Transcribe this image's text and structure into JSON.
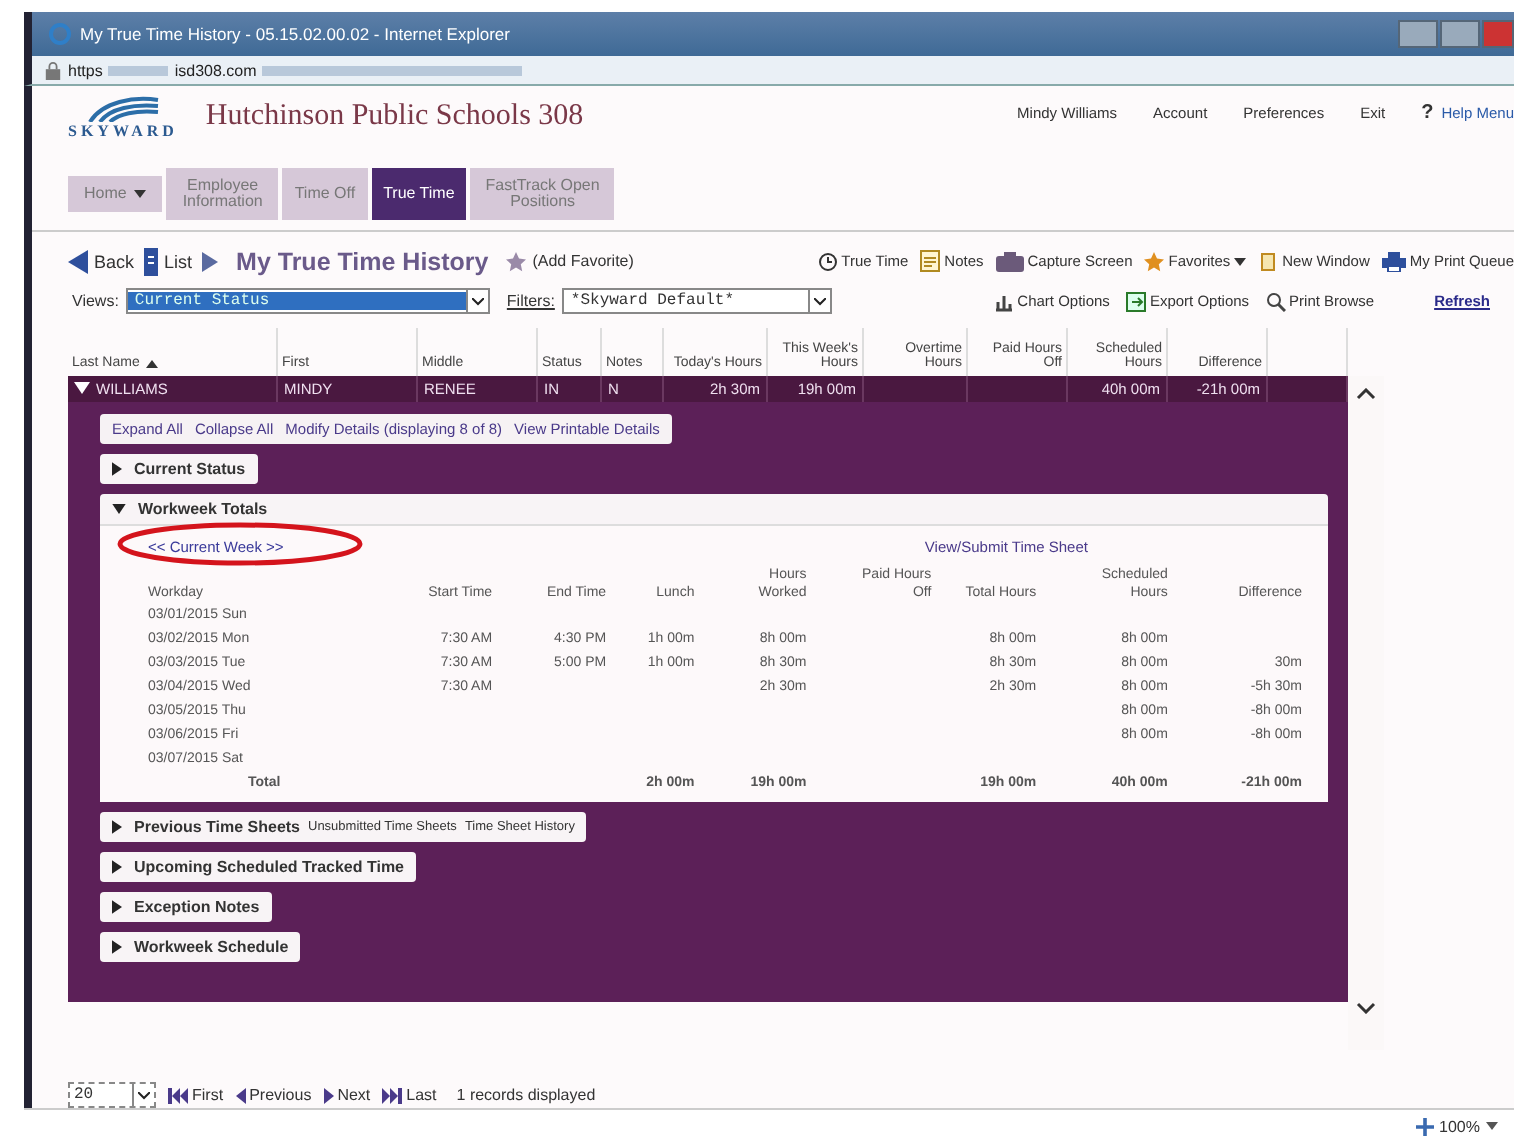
{
  "browser": {
    "title": "My True Time History - 05.15.02.00.02 - Internet Explorer",
    "url_scheme": "https",
    "url_domain": "isd308.com",
    "zoom": "100%"
  },
  "header": {
    "school": "Hutchinson Public Schools 308",
    "logo": "SKYWARD",
    "user_links": [
      "Mindy Williams",
      "Account",
      "Preferences",
      "Exit"
    ],
    "help_mark": "?",
    "help": "Help Menu"
  },
  "nav": [
    {
      "label": "Home",
      "dropdown": true,
      "selected": false
    },
    {
      "label": "Employee Information",
      "dropdown": false,
      "selected": false
    },
    {
      "label": "Time Off",
      "dropdown": false,
      "selected": false
    },
    {
      "label": "True Time",
      "dropdown": false,
      "selected": true
    },
    {
      "label": "FastTrack Open Positions",
      "dropdown": false,
      "selected": false
    }
  ],
  "toolbar": {
    "back": "Back",
    "list": "List",
    "page_title": "My True Time History",
    "add_favorite": "(Add Favorite)",
    "tools": [
      {
        "kind": "clock",
        "label": "True Time"
      },
      {
        "kind": "notes",
        "label": "Notes"
      },
      {
        "kind": "camera",
        "label": "Capture Screen"
      },
      {
        "kind": "star",
        "label": "Favorites"
      },
      {
        "kind": "window",
        "label": "New Window"
      },
      {
        "kind": "printer",
        "label": "My Print Queue"
      }
    ]
  },
  "views": {
    "label": "Views:",
    "value": "Current Status",
    "filters_label": "Filters:",
    "filters_value": "*Skyward Default*",
    "options": [
      {
        "kind": "chart",
        "label": "Chart Options"
      },
      {
        "kind": "export",
        "label": "Export Options"
      },
      {
        "kind": "print",
        "label": "Print Browse"
      }
    ],
    "refresh": "Refresh"
  },
  "grid": {
    "columns": [
      {
        "label": "Last Name",
        "sorted": true
      },
      {
        "label": "First",
        "sorted": false
      },
      {
        "label": "Middle",
        "sorted": false
      },
      {
        "label": "Status",
        "sorted": false
      },
      {
        "label": "Notes",
        "sorted": false
      },
      {
        "label": "Today's Hours",
        "sorted": false
      },
      {
        "label": "This Week's Hours",
        "sorted": false
      },
      {
        "label": "Overtime Hours",
        "sorted": false
      },
      {
        "label": "Paid Hours Off",
        "sorted": false
      },
      {
        "label": "Scheduled Hours",
        "sorted": false
      },
      {
        "label": "Difference",
        "sorted": false
      }
    ],
    "row": {
      "expanded": true,
      "cells": [
        "WILLIAMS",
        "MINDY",
        "RENEE",
        "IN",
        "N",
        "2h 30m",
        "19h 00m",
        "",
        "",
        "40h 00m",
        "-21h 00m"
      ]
    }
  },
  "detail_links": [
    "Expand All",
    "Collapse All",
    "Modify Details (displaying 8 of 8)",
    "View Printable Details"
  ],
  "sections": [
    {
      "title": "Current Status",
      "expanded": false
    },
    {
      "title": "Workweek Totals",
      "expanded": true,
      "week_nav": "<< Current Week >>",
      "submit_link": "View/Submit Time Sheet",
      "columns": [
        "Workday",
        "Start Time",
        "End Time",
        "Lunch",
        "Hours Worked",
        "Paid Hours Off",
        "Total Hours",
        "Scheduled Hours",
        "Difference"
      ],
      "rows": [
        [
          "03/01/2015 Sun",
          "",
          "",
          "",
          "",
          "",
          "",
          "",
          ""
        ],
        [
          "03/02/2015 Mon",
          "7:30 AM",
          "4:30 PM",
          "1h 00m",
          "8h 00m",
          "",
          "8h 00m",
          "8h 00m",
          ""
        ],
        [
          "03/03/2015 Tue",
          "7:30 AM",
          "5:00 PM",
          "1h 00m",
          "8h 30m",
          "",
          "8h 30m",
          "8h 00m",
          "30m"
        ],
        [
          "03/04/2015 Wed",
          "7:30 AM",
          "",
          "",
          "2h 30m",
          "",
          "2h 30m",
          "8h 00m",
          "-5h 30m"
        ],
        [
          "03/05/2015 Thu",
          "",
          "",
          "",
          "",
          "",
          "",
          "8h 00m",
          "-8h 00m"
        ],
        [
          "03/06/2015 Fri",
          "",
          "",
          "",
          "",
          "",
          "",
          "8h 00m",
          "-8h 00m"
        ],
        [
          "03/07/2015 Sat",
          "",
          "",
          "",
          "",
          "",
          "",
          "",
          ""
        ]
      ],
      "total": {
        "label": "Total",
        "lunch": "2h 00m",
        "hours_worked": "19h 00m",
        "total_hours": "19h 00m",
        "scheduled_hours": "40h 00m",
        "difference": "-21h 00m"
      }
    },
    {
      "title": "Previous Time Sheets",
      "expanded": false,
      "links": [
        "Unsubmitted Time Sheets",
        "Time Sheet History"
      ]
    },
    {
      "title": "Upcoming Scheduled Tracked Time",
      "expanded": false
    },
    {
      "title": "Exception Notes",
      "expanded": false
    },
    {
      "title": "Workweek Schedule",
      "expanded": false
    }
  ],
  "pager": {
    "page_size": "20",
    "first": "First",
    "previous": "Previous",
    "next": "Next",
    "last": "Last",
    "info": "1 records displayed"
  }
}
